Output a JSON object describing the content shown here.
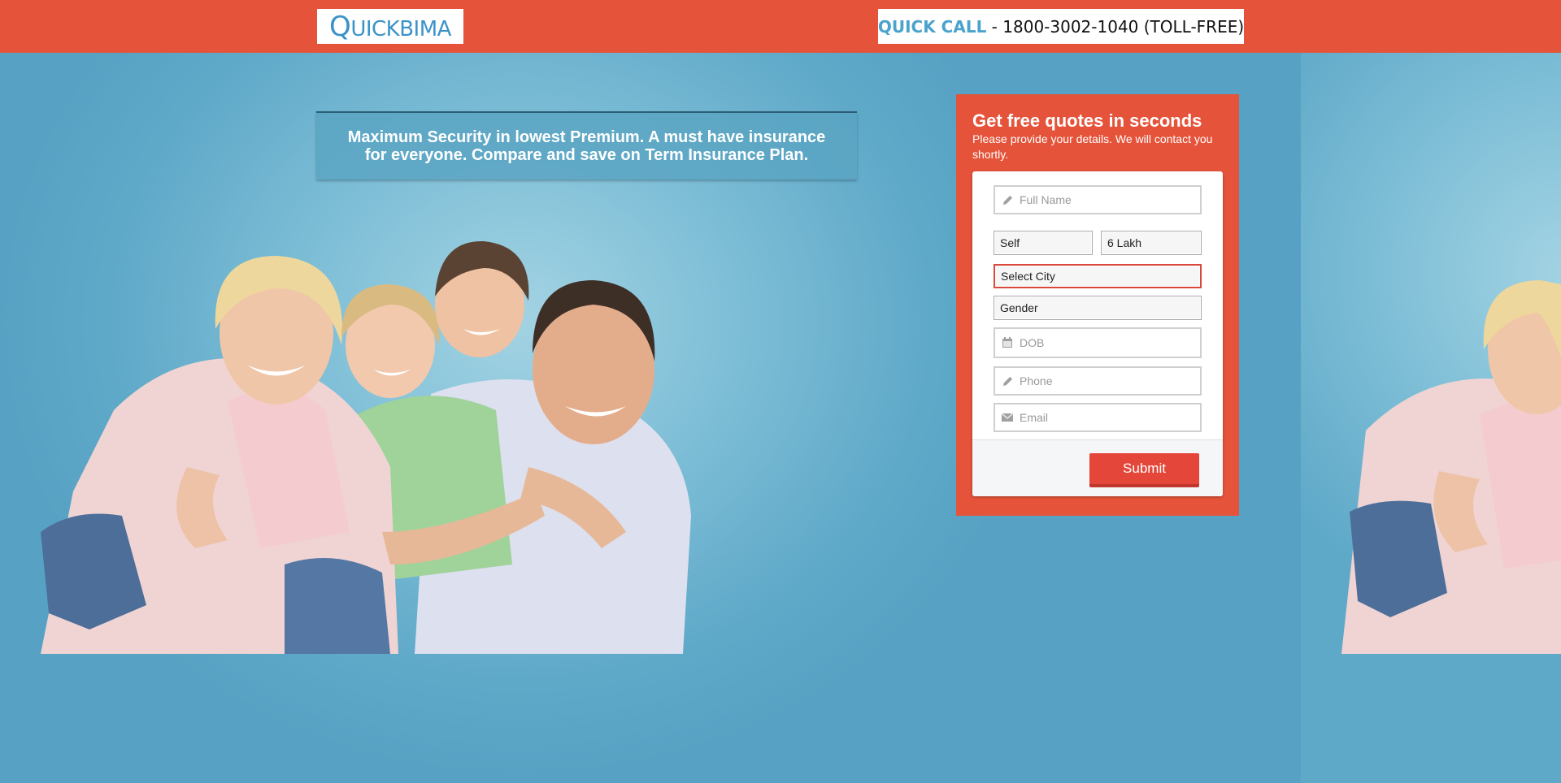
{
  "header": {
    "logo": {
      "first_letter": "Q",
      "rest": "UICKBIMA"
    },
    "quick_call": {
      "label": "QUICK CALL",
      "separator": " - ",
      "number": "1800-3002-1040 (TOLL-FREE)"
    }
  },
  "hero": {
    "tagline": "Maximum Security in lowest Premium. A must have insurance for everyone. Compare and save on Term Insurance Plan."
  },
  "form": {
    "title": "Get free quotes in seconds",
    "subtitle": "Please provide your details. We will contact you shortly.",
    "full_name": {
      "placeholder": "Full Name",
      "icon": "pencil-icon"
    },
    "relation": {
      "value": "Self"
    },
    "cover": {
      "value": "6 Lakh"
    },
    "city": {
      "value": "Select City"
    },
    "gender": {
      "value": "Gender"
    },
    "dob": {
      "placeholder": "DOB",
      "icon": "calendar-icon"
    },
    "phone": {
      "placeholder": "Phone",
      "icon": "pencil-icon"
    },
    "email": {
      "placeholder": "Email",
      "icon": "envelope-icon"
    },
    "submit_label": "Submit"
  },
  "colors": {
    "brand_orange": "#e5533a",
    "logo_blue": "#3b93c8",
    "error_red": "#d9483b"
  }
}
